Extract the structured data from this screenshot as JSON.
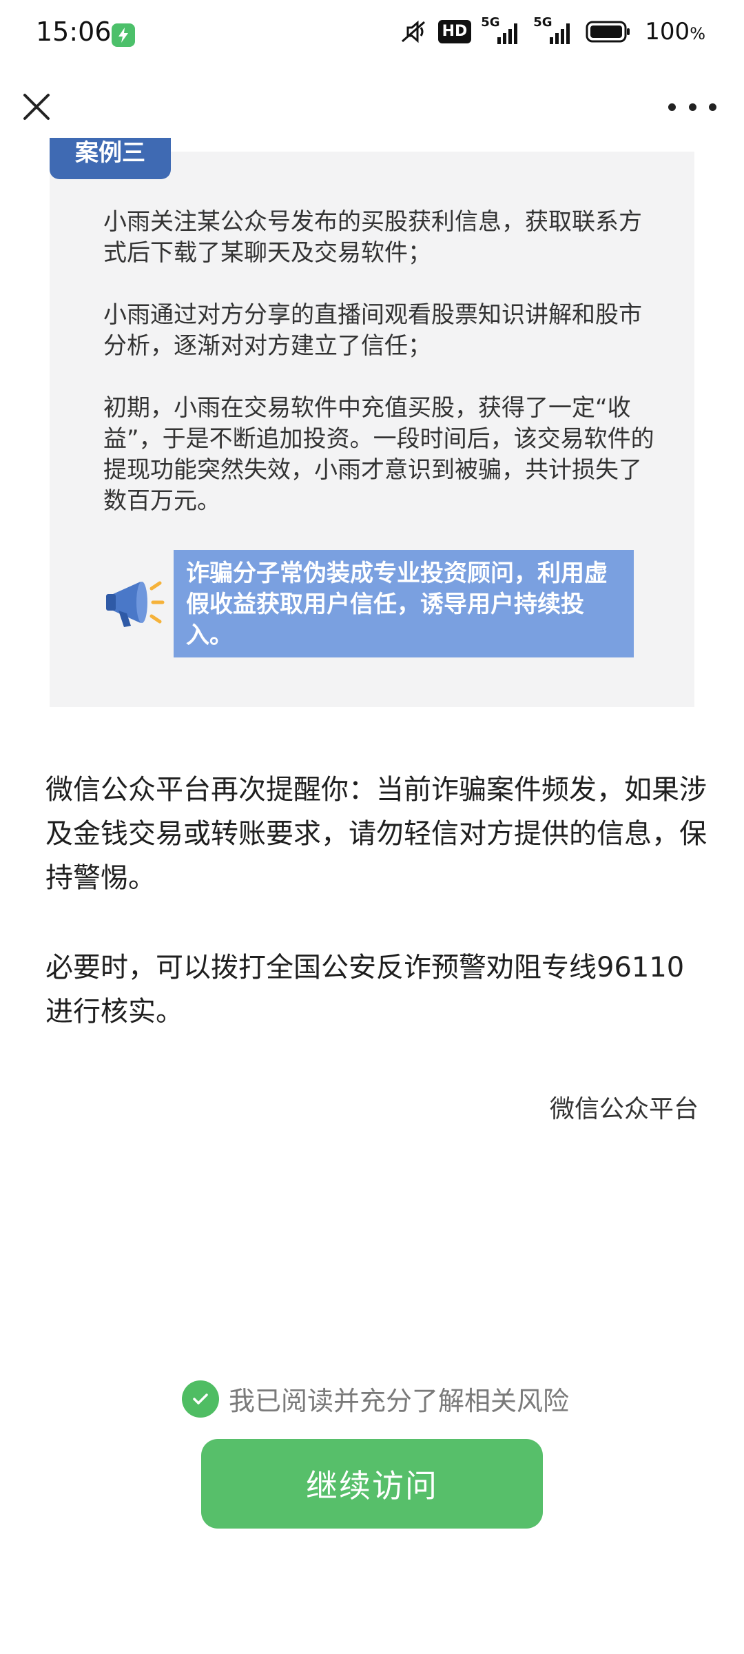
{
  "status_bar": {
    "time": "15:06",
    "icons": [
      "battery-saver-icon",
      "mute-icon",
      "hd-icon",
      "signal-5g-icon",
      "signal-5g-icon",
      "battery-icon"
    ],
    "network_1": "5G",
    "network_2": "5G",
    "hd": "HD",
    "battery_value": "100",
    "battery_unit": "%"
  },
  "nav": {
    "close_icon": "close-icon",
    "more_icon": "more-dots-icon"
  },
  "case": {
    "tag": "案例三",
    "paragraphs": [
      "小雨关注某公众号发布的买股获利信息，获取联系方式后下载了某聊天及交易软件；",
      "小雨通过对方分享的直播间观看股票知识讲解和股市分析，逐渐对对方建立了信任；",
      "初期，小雨在交易软件中充值买股，获得了一定“收益”，于是不断追加投资。一段时间后，该交易软件的提现功能突然失效，小雨才意识到被骗，共计损失了数百万元。"
    ],
    "alert": "诈骗分子常伪装成专业投资顾问，利用虚假收益获取用户信任，诱导用户持续投入。"
  },
  "reminder": {
    "line1": "微信公众平台再次提醒你：当前诈骗案件频发，如果涉及金钱交易或转账要求，请勿轻信对方提供的信息，保持警惕。",
    "line2": "必要时，可以拨打全国公安反诈预警劝阻专线96110进行核实。",
    "signature": "微信公众平台"
  },
  "footer": {
    "consent_label": "我已阅读并充分了解相关风险",
    "consent_checked": true,
    "continue_label": "继续访问",
    "accent_color": "#57bf6a"
  }
}
